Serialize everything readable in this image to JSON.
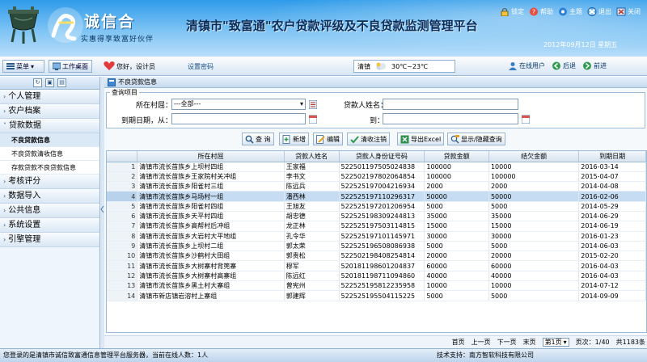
{
  "header": {
    "logo_name": "诚信合",
    "logo_sub": "实惠得享致富好伙伴",
    "system_title": "清镇市\"致富通\"农户贷款评级及不良贷款监测管理平台",
    "date": "2012年09月12日 星期五",
    "top_links": [
      {
        "label": "锁定",
        "icon": "lock-icon"
      },
      {
        "label": "帮助",
        "icon": "help-icon"
      },
      {
        "label": "主题",
        "icon": "theme-icon"
      },
      {
        "label": "退出",
        "icon": "exit-icon"
      },
      {
        "label": "关闭",
        "icon": "close-icon"
      }
    ]
  },
  "toolbar": {
    "menu_label": "菜单",
    "desktop_label": "工作桌面",
    "greeting": "您好，设计员",
    "change_password": "设置密码",
    "city": "清镇",
    "temperature": "30℃~23℃",
    "online_users": "在线用户",
    "back": "后退",
    "forward": "前进"
  },
  "sidebar": {
    "items": [
      {
        "label": "个人管理",
        "expanded": false
      },
      {
        "label": "农户档案",
        "expanded": false
      },
      {
        "label": "贷款数据",
        "expanded": true
      }
    ],
    "sub_items": [
      "不良贷款信息",
      "不良贷款清收信息",
      "存款贷款不良贷款信息"
    ],
    "active_sub": "不良贷款信息",
    "more_items": [
      "考核评分",
      "数据导入",
      "公共信息",
      "系统设置",
      "引擎管理"
    ]
  },
  "page": {
    "title": "不良贷款信息"
  },
  "query": {
    "legend": "查询项目",
    "village_label": "所在村屈：",
    "village_value": "---全部---",
    "borrower_label": "贷款人姓名：",
    "borrower_value": "",
    "due_from_label": "到期日期，从：",
    "due_to_label": "到：",
    "due_from_value": "",
    "due_to_value": ""
  },
  "actions": {
    "search": "查 询",
    "add": "新增",
    "edit": "编辑",
    "collect": "清收注销",
    "export": "导出Excel",
    "toggle": "显示/隐藏查询"
  },
  "grid": {
    "columns": [
      "所在村屈",
      "贷款人姓名",
      "贷款人身份证号码",
      "贷款金额",
      "结欠金额",
      "到期日期"
    ],
    "highlighted_row": 4,
    "rows": [
      {
        "n": "1",
        "village": "清镇市流长苗族乡上坝村四组",
        "name": "王家福",
        "id": "522501197505024838",
        "amount": "100000",
        "owed": "10000",
        "due": "2016-03-14"
      },
      {
        "n": "2",
        "village": "清镇市流长苗族乡王家院村关冲组",
        "name": "李书文",
        "id": "522502197802064854",
        "amount": "100000",
        "owed": "100000",
        "due": "2015-04-07"
      },
      {
        "n": "3",
        "village": "清镇市流长苗族乡阳雀村三组",
        "name": "陈远兵",
        "id": "522525197004216934",
        "amount": "2000",
        "owed": "2000",
        "due": "2014-04-08"
      },
      {
        "n": "4",
        "village": "清镇市流长苗族乡马场村一组",
        "name": "潘西林",
        "id": "522525197110296317",
        "amount": "50000",
        "owed": "50000",
        "due": "2016-02-06"
      },
      {
        "n": "5",
        "village": "清镇市流长苗族乡阳雀村四组",
        "name": "王旭友",
        "id": "522525197201206954",
        "amount": "5000",
        "owed": "5000",
        "due": "2014-05-29"
      },
      {
        "n": "6",
        "village": "清镇市流长苗族乡天平村四组",
        "name": "胡忠德",
        "id": "522525198309244813",
        "amount": "35000",
        "owed": "35000",
        "due": "2014-06-29"
      },
      {
        "n": "7",
        "village": "清镇市流长苗族乡高帮村后冲组",
        "name": "龙正林",
        "id": "522525197503114815",
        "amount": "15000",
        "owed": "15000",
        "due": "2014-06-19"
      },
      {
        "n": "8",
        "village": "清镇市流长苗族乡大岩村大平地组",
        "name": "孔令华",
        "id": "522525197101145971",
        "amount": "30000",
        "owed": "30000",
        "due": "2016-01-23"
      },
      {
        "n": "9",
        "village": "清镇市流长苗族乡上坝村二组",
        "name": "郭太荣",
        "id": "522525196508086938",
        "amount": "5000",
        "owed": "5000",
        "due": "2014-06-03"
      },
      {
        "n": "10",
        "village": "清镇市流长苗族乡沙鹤村大田组",
        "name": "郭贵松",
        "id": "522502198408254814",
        "amount": "20000",
        "owed": "20000",
        "due": "2015-02-20"
      },
      {
        "n": "11",
        "village": "清镇市流长苗族乡大树寨村背篼寨",
        "name": "穆军",
        "id": "520181198601204837",
        "amount": "60000",
        "owed": "60000",
        "due": "2016-04-03"
      },
      {
        "n": "12",
        "village": "清镇市流长苗族乡大树寨村高寨组",
        "name": "陈远红",
        "id": "520181198711094860",
        "amount": "40000",
        "owed": "40000",
        "due": "2016-04-03"
      },
      {
        "n": "13",
        "village": "清镇市流长苗族乡黑土村大寨组",
        "name": "曾宪州",
        "id": "522525195812235958",
        "amount": "10000",
        "owed": "10000",
        "due": "2014-07-12"
      },
      {
        "n": "14",
        "village": "清镇市新店镇岩溶村上寨组",
        "name": "郭建辉",
        "id": "522525195504115225",
        "amount": "5000",
        "owed": "5000",
        "due": "2014-09-09"
      }
    ]
  },
  "pager": {
    "first": "首页",
    "prev": "上一页",
    "next": "下一页",
    "last": "末页",
    "page_select": "第1页",
    "page_info": "页次：1/40",
    "total": "共1183条"
  },
  "status": {
    "left": "您登录的是清镇市诚信致富通信息管理平台服务器，当前在线人数：1人",
    "right": "技术支持：南方智软科技有限公司"
  },
  "colors": {
    "header_top": "#2f9be9",
    "grid_header": "#d6e3f0",
    "highlight": "#c6dcf2"
  }
}
